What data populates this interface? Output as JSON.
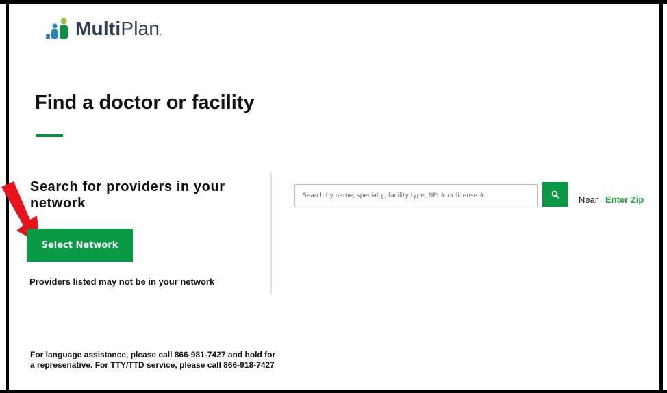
{
  "header": {
    "logo": {
      "brand_bold": "Multi",
      "brand_light": "Plan",
      "brand_mark": ".",
      "icon": "multiplan-logo-icon"
    }
  },
  "page": {
    "title": "Find a doctor or facility",
    "accent_color": "#0a8f43"
  },
  "network_section": {
    "heading": "Search for providers in your network",
    "select_network_label": "Select Network",
    "disclaimer": "Providers listed may not be in your network"
  },
  "search": {
    "placeholder": "Search by name, specialty, facility type, NPI # or license #",
    "value": "",
    "search_icon": "search-icon",
    "near_label": "Near",
    "zip_link": "Enter Zip"
  },
  "footer": {
    "language_note": "For language assistance, please call 866-981-7427 and hold for a represenative. For TTY/TTD service, please call 866-918-7427"
  },
  "annotations": {
    "arrow_color": "#e8141b",
    "arrow_icon": "red-arrow-icon"
  }
}
